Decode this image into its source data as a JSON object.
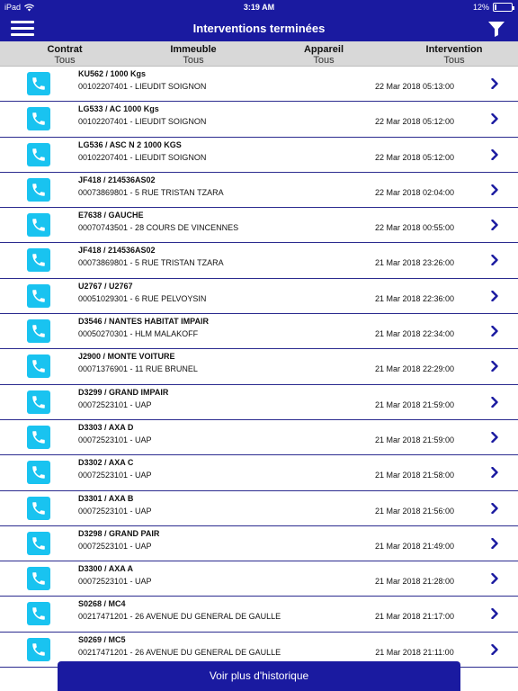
{
  "status_bar": {
    "device": "iPad",
    "time": "3:19 AM",
    "battery": "12%",
    "battery_level": 0.12
  },
  "nav": {
    "title": "Interventions terminées",
    "menu_icon": "hamburger-menu-icon",
    "filter_icon": "filter-funnel-icon"
  },
  "columns": [
    {
      "header": "Contrat",
      "value": "Tous"
    },
    {
      "header": "Immeuble",
      "value": "Tous"
    },
    {
      "header": "Appareil",
      "value": "Tous"
    },
    {
      "header": "Intervention",
      "value": "Tous"
    }
  ],
  "rows": [
    {
      "title": "KU562 / 1000 Kgs",
      "subtitle": "00102207401 - LIEUDIT SOIGNON",
      "date": "22 Mar 2018 05:13:00"
    },
    {
      "title": "LG533 / AC 1000 Kgs",
      "subtitle": "00102207401 - LIEUDIT SOIGNON",
      "date": "22 Mar 2018 05:12:00"
    },
    {
      "title": "LG536 / ASC N 2  1000 KGS",
      "subtitle": "00102207401 - LIEUDIT SOIGNON",
      "date": "22 Mar 2018 05:12:00"
    },
    {
      "title": "JF418 / 214536AS02",
      "subtitle": "00073869801 - 5 RUE TRISTAN TZARA",
      "date": "22 Mar 2018 02:04:00"
    },
    {
      "title": "E7638 / GAUCHE",
      "subtitle": "00070743501 - 28 COURS DE VINCENNES",
      "date": "22 Mar 2018 00:55:00"
    },
    {
      "title": "JF418 / 214536AS02",
      "subtitle": "00073869801 - 5 RUE TRISTAN TZARA",
      "date": "21 Mar 2018 23:26:00"
    },
    {
      "title": "U2767 / U2767",
      "subtitle": "00051029301 - 6 RUE PELVOYSIN",
      "date": "21 Mar 2018 22:36:00"
    },
    {
      "title": "D3546 / NANTES HABITAT IMPAIR",
      "subtitle": "00050270301 - HLM MALAKOFF",
      "date": "21 Mar 2018 22:34:00"
    },
    {
      "title": "J2900 / MONTE VOITURE",
      "subtitle": "00071376901 - 11 RUE BRUNEL",
      "date": "21 Mar 2018 22:29:00"
    },
    {
      "title": "D3299 / GRAND  IMPAIR",
      "subtitle": "00072523101 - UAP",
      "date": "21 Mar 2018 21:59:00"
    },
    {
      "title": "D3303 / AXA D",
      "subtitle": "00072523101 - UAP",
      "date": "21 Mar 2018 21:59:00"
    },
    {
      "title": "D3302 / AXA C",
      "subtitle": "00072523101 - UAP",
      "date": "21 Mar 2018 21:58:00"
    },
    {
      "title": "D3301 / AXA B",
      "subtitle": "00072523101 - UAP",
      "date": "21 Mar 2018 21:56:00"
    },
    {
      "title": "D3298 / GRAND  PAIR",
      "subtitle": "00072523101 - UAP",
      "date": "21 Mar 2018 21:49:00"
    },
    {
      "title": "D3300 / AXA A",
      "subtitle": "00072523101 - UAP",
      "date": "21 Mar 2018 21:28:00"
    },
    {
      "title": "S0268 / MC4",
      "subtitle": "00217471201 - 26 AVENUE DU GENERAL DE GAULLE",
      "date": "21 Mar 2018 21:17:00"
    },
    {
      "title": "S0269 / MC5",
      "subtitle": "00217471201 - 26 AVENUE DU GENERAL DE GAULLE",
      "date": "21 Mar 2018 21:11:00"
    }
  ],
  "footer": {
    "more_label": "Voir plus d'historique"
  },
  "colors": {
    "brand": "#1a1aa0",
    "phone_badge": "#19c3f0",
    "chevron": "#1a1aa0",
    "header_bg": "#d8d8d8"
  }
}
